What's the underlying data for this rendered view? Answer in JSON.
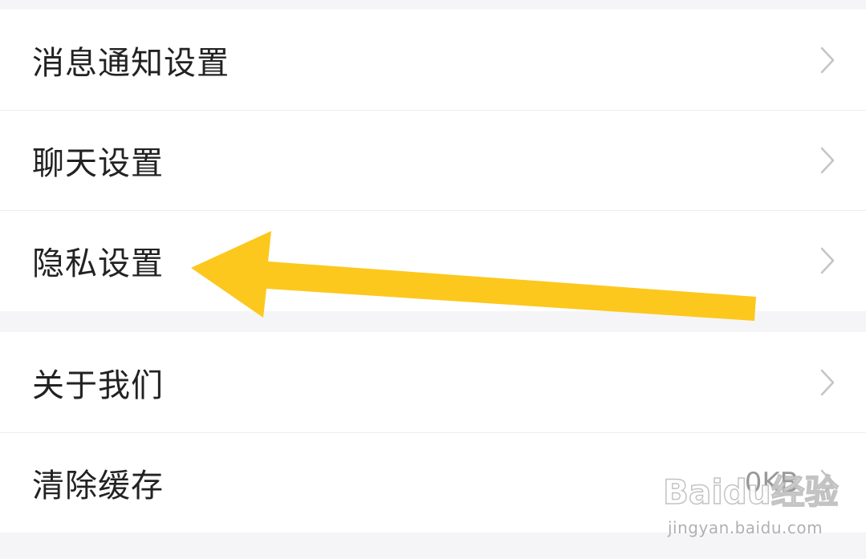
{
  "settings": {
    "group1": [
      {
        "label": "消息通知设置"
      },
      {
        "label": "聊天设置"
      },
      {
        "label": "隐私设置"
      }
    ],
    "group2": [
      {
        "label": "关于我们"
      },
      {
        "label": "清除缓存",
        "value": "0KB"
      }
    ]
  },
  "watermark": {
    "logo_text": "Baidu经验",
    "url": "jingyan.baidu.com"
  },
  "colors": {
    "arrow": "#fcc81e",
    "background": "#f5f5f7",
    "row_background": "#ffffff",
    "chevron": "#c4c4c4"
  },
  "icons": {
    "chevron": "chevron-right-icon"
  }
}
